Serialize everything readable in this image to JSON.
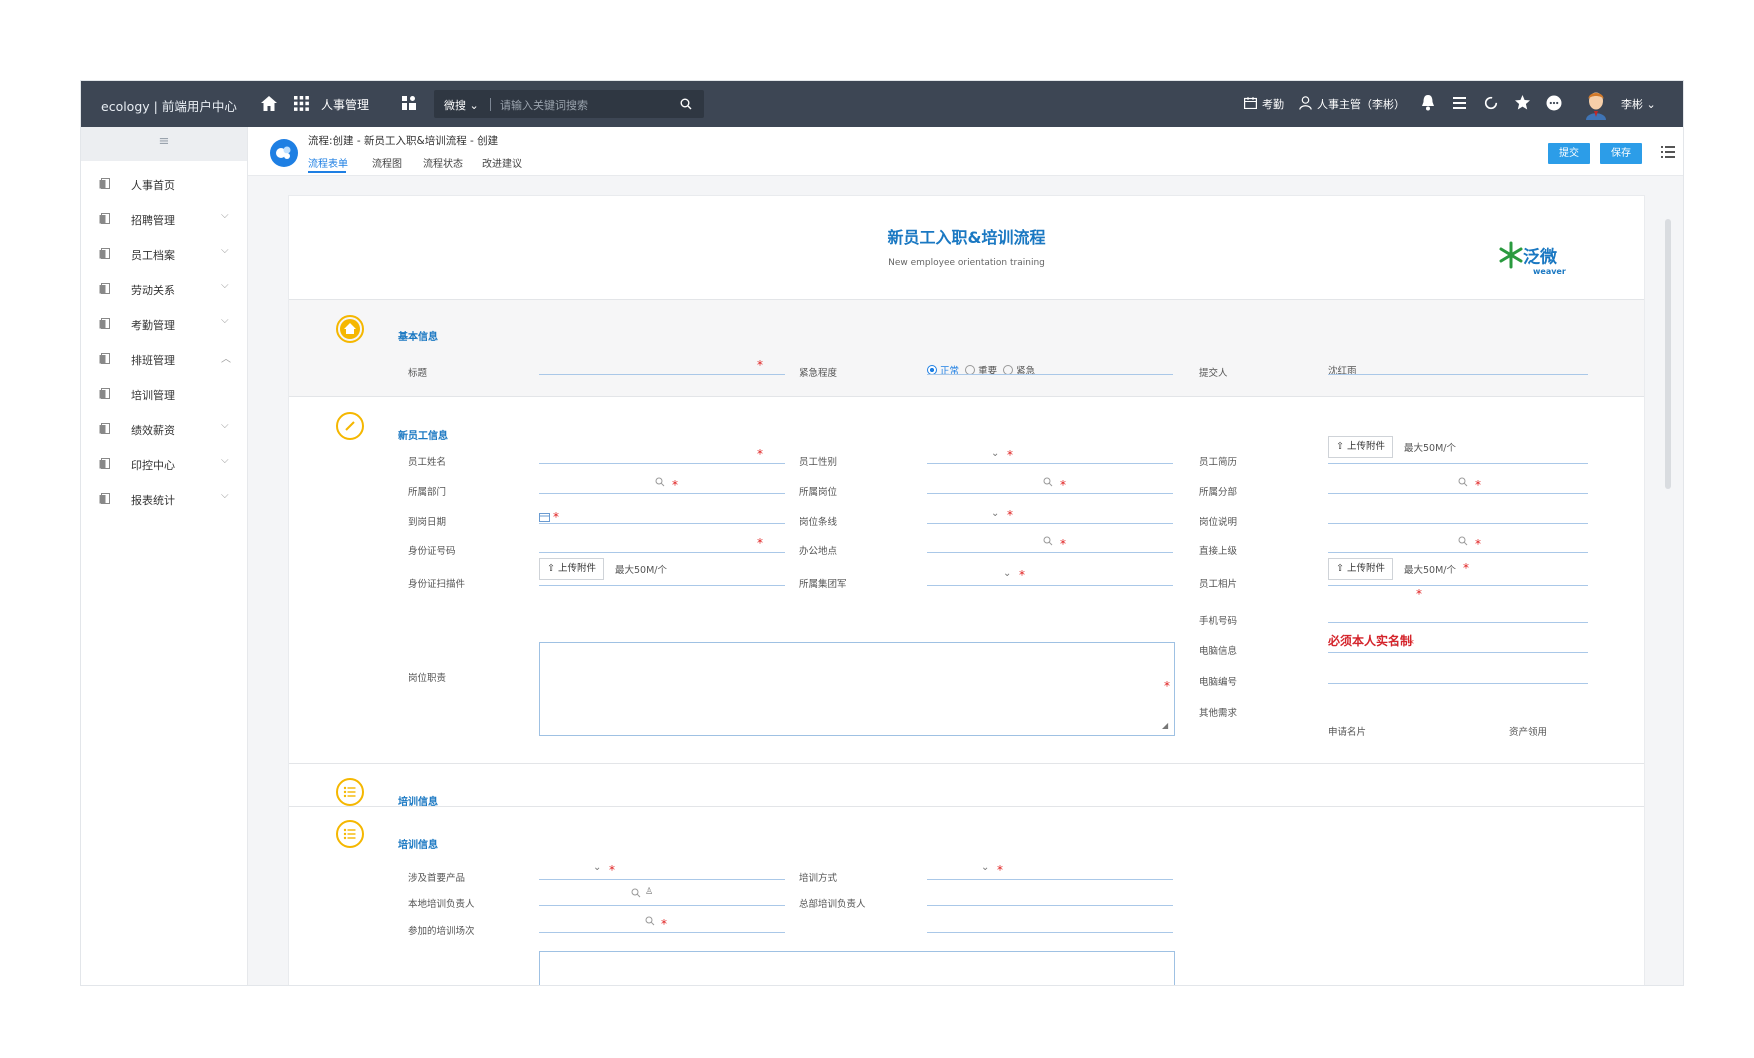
{
  "topbar": {
    "brand": "ecology | 前端用户中心",
    "module": "人事管理",
    "search_scope": "微搜",
    "search_placeholder": "请输入关键词搜索",
    "attendance": "考勤",
    "role": "人事主管（李彬）",
    "user": "李彬"
  },
  "sidebar": {
    "items": [
      {
        "label": "人事首页",
        "arrow": ""
      },
      {
        "label": "招聘管理",
        "arrow": "⌵"
      },
      {
        "label": "员工档案",
        "arrow": "⌵"
      },
      {
        "label": "劳动关系",
        "arrow": "⌵"
      },
      {
        "label": "考勤管理",
        "arrow": "⌵"
      },
      {
        "label": "排班管理",
        "arrow": "︿"
      },
      {
        "label": "培训管理",
        "arrow": ""
      },
      {
        "label": "绩效薪资",
        "arrow": "⌵"
      },
      {
        "label": "印控中心",
        "arrow": "⌵"
      },
      {
        "label": "报表统计",
        "arrow": "⌵"
      }
    ]
  },
  "workflow": {
    "breadcrumb": "流程:创建 - 新员工入职&培训流程 - 创建",
    "tabs": [
      "流程表单",
      "流程图",
      "流程状态",
      "改进建议"
    ],
    "submit_label": "提交",
    "save_label": "保存"
  },
  "form": {
    "title": "新员工入职&培训流程",
    "subtitle": "New employee orientation training",
    "logo_text": "泛微",
    "logo_sub": "weaver",
    "basic": {
      "section_title": "基本信息",
      "title_label": "标题",
      "urgency_label": "紧急程度",
      "urgency_options": [
        "正常",
        "重要",
        "紧急"
      ],
      "urgency_selected": "正常",
      "submitter_label": "提交人",
      "submitter_value": "沈红雨"
    },
    "employee": {
      "section_title": "新员工信息",
      "labels": {
        "name": "员工姓名",
        "gender": "员工性别",
        "resume": "员工简历",
        "dept": "所属部门",
        "post": "所属岗位",
        "branch": "所属分部",
        "date": "到岗日期",
        "level": "岗位条线",
        "post_desc": "岗位说明",
        "idno": "身份证号码",
        "office": "办公地点",
        "superior": "直接上级",
        "idscan": "身份证扫描件",
        "group": "所属集团军",
        "photo": "员工相片",
        "phone": "手机号码",
        "duty": "岗位职责",
        "pc_info": "电脑信息",
        "pc_no": "电脑编号",
        "other": "其他需求"
      },
      "upload_label": "上传附件",
      "upload_limit": "最大50M/个",
      "phone_hint": "必须本人实名制",
      "other_options": [
        "申请名片",
        "资产领用"
      ]
    },
    "training1": {
      "section_title": "培训信息"
    },
    "training2": {
      "section_title": "培训信息",
      "labels": {
        "product": "涉及首要产品",
        "method": "培训方式",
        "local_owner": "本地培训负责人",
        "hq_owner": "总部培训负责人",
        "session": "参加的培训场次"
      }
    }
  }
}
